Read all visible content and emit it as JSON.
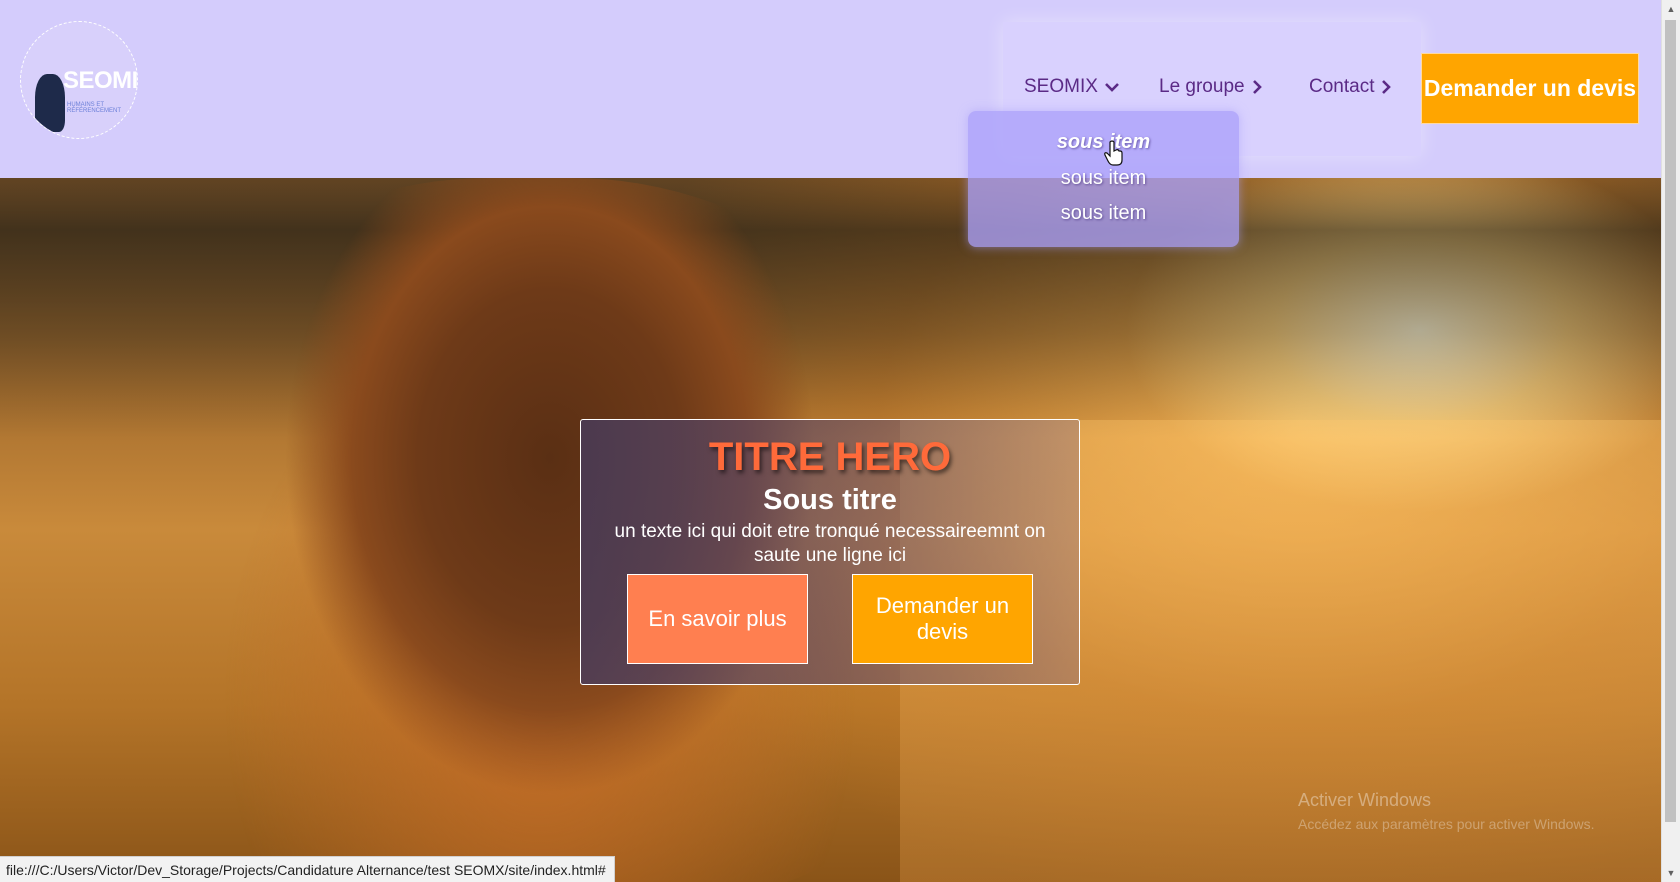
{
  "header": {
    "logo": {
      "text": "SEOMIX",
      "tagline": "HUMAINS ET RÉFÉRENCEMENT"
    },
    "nav": [
      {
        "label": "SEOMIX",
        "icon": "chevron-down-icon"
      },
      {
        "label": "Le groupe",
        "icon": "chevron-right-icon"
      },
      {
        "label": "Contact",
        "icon": "chevron-right-icon"
      }
    ],
    "cta_label": "Demander un devis"
  },
  "dropdown": {
    "items": [
      "sous item",
      "sous item",
      "sous item"
    ],
    "hovered_index": 0
  },
  "hero": {
    "title": "TITRE HERO",
    "subtitle": "Sous titre",
    "text": "un texte ici qui doit etre tronqué necessaireemnt on saute une ligne ici",
    "buttons": {
      "learn_more": "En savoir plus",
      "quote": "Demander un devis"
    }
  },
  "watermark": {
    "title": "Activer Windows",
    "subtitle": "Accédez aux paramètres pour activer Windows."
  },
  "status_bar": {
    "url": "file:///C:/Users/Victor/Dev_Storage/Projects/Candidature Alternance/test SEOMX/site/index.html#"
  },
  "colors": {
    "header_bg": "#d4ccfc",
    "nav_text": "#5b2a86",
    "accent_orange": "#ffa500",
    "coral": "#ff7f50",
    "hero_title": "#ff6a3a"
  }
}
